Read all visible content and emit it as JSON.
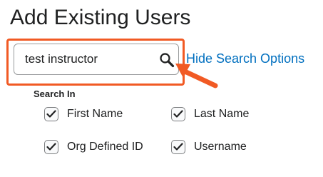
{
  "page": {
    "title": "Add Existing Users"
  },
  "search": {
    "value": "test instructor",
    "hide_options_label": "Hide Search Options"
  },
  "search_in": {
    "label": "Search In",
    "options": [
      {
        "label": "First Name",
        "checked": true
      },
      {
        "label": "Last Name",
        "checked": true
      },
      {
        "label": "Org Defined ID",
        "checked": true
      },
      {
        "label": "Username",
        "checked": true
      }
    ]
  },
  "colors": {
    "highlight": "#f15a24",
    "link": "#006fbf"
  },
  "icons": {
    "search": "magnifier-icon",
    "annotation": "arrow-icon",
    "check": "checkmark-icon"
  }
}
